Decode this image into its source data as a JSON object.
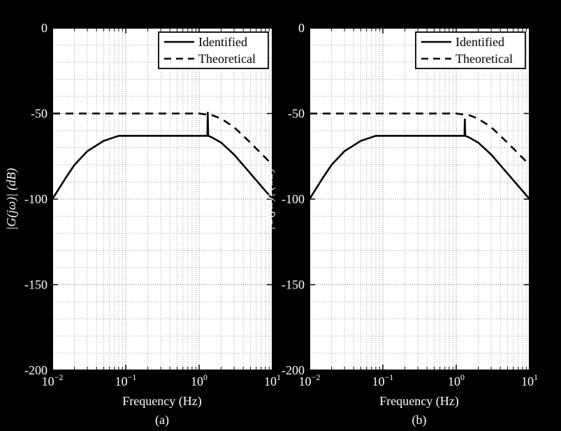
{
  "chart_data": [
    {
      "type": "line",
      "title": "(a)",
      "xlabel": "Frequency (Hz)",
      "ylabel": "|G(jω)| (dB)",
      "xscale": "log",
      "xticks": [
        0.01,
        0.1,
        1,
        10
      ],
      "xticklabels": [
        "10^{-2}",
        "10^{-1}",
        "10^{0}",
        "10^{1}"
      ],
      "xlim": [
        0.01,
        10
      ],
      "yticks": [
        -200,
        -150,
        -100,
        -50,
        0
      ],
      "ylim": [
        -200,
        0
      ],
      "grid": true,
      "legend": {
        "position": "upper-right",
        "entries": [
          "Identified",
          "Theoretical"
        ]
      },
      "series": [
        {
          "name": "Identified",
          "style": "solid",
          "x": [
            0.01,
            0.015,
            0.02,
            0.03,
            0.05,
            0.08,
            0.1,
            0.2,
            0.3,
            0.5,
            1,
            1.3,
            1.31,
            1.33,
            1.5,
            2,
            3,
            5,
            10
          ],
          "y": [
            -100,
            -88,
            -80,
            -72,
            -66,
            -63,
            -63,
            -63,
            -63,
            -63,
            -63,
            -63,
            -49,
            -63,
            -64,
            -67,
            -74,
            -85,
            -100
          ]
        },
        {
          "name": "Theoretical",
          "style": "dashed",
          "x": [
            0.01,
            0.05,
            0.1,
            0.3,
            1,
            1.5,
            2,
            3,
            5,
            10
          ],
          "y": [
            -50,
            -50,
            -50,
            -50,
            -50,
            -51,
            -53,
            -58,
            -67,
            -80
          ]
        }
      ]
    },
    {
      "type": "line",
      "title": "(b)",
      "xlabel": "Frequency (Hz)",
      "ylabel": "|G(jω)| (dB)",
      "xscale": "log",
      "xticks": [
        0.01,
        0.1,
        1,
        10
      ],
      "xticklabels": [
        "10^{-2}",
        "10^{-1}",
        "10^{0}",
        "10^{1}"
      ],
      "xlim": [
        0.01,
        10
      ],
      "yticks": [
        -200,
        -150,
        -100,
        -50,
        0
      ],
      "ylim": [
        -200,
        0
      ],
      "grid": true,
      "legend": {
        "position": "upper-right",
        "entries": [
          "Identified",
          "Theoretical"
        ]
      },
      "series": [
        {
          "name": "Identified",
          "style": "solid",
          "x": [
            0.01,
            0.015,
            0.02,
            0.03,
            0.05,
            0.08,
            0.1,
            0.2,
            0.3,
            0.5,
            1,
            1.3,
            1.31,
            1.33,
            1.5,
            2,
            3,
            5,
            10
          ],
          "y": [
            -100,
            -88,
            -80,
            -72,
            -66,
            -63,
            -63,
            -63,
            -63,
            -63,
            -63,
            -63,
            -53,
            -63,
            -64,
            -67,
            -74,
            -85,
            -100
          ]
        },
        {
          "name": "Theoretical",
          "style": "dashed",
          "x": [
            0.01,
            0.05,
            0.1,
            0.3,
            1,
            1.5,
            2,
            3,
            5,
            10
          ],
          "y": [
            -50,
            -50,
            -50,
            -50,
            -50,
            -51,
            -53,
            -58,
            -67,
            -80
          ]
        }
      ]
    }
  ],
  "legend_labels": {
    "identified": "Identified",
    "theoretical": "Theoretical"
  },
  "axis_labels": {
    "x": "Frequency (Hz)",
    "y": "|G(jω)| (dB)"
  },
  "subtitles": {
    "a": "(a)",
    "b": "(b)"
  },
  "xtick_parts": {
    "base": "10",
    "exps": [
      "−2",
      "−1",
      "0",
      "1"
    ]
  },
  "yticks_display": [
    "-200",
    "-150",
    "-100",
    "-50",
    "0"
  ]
}
